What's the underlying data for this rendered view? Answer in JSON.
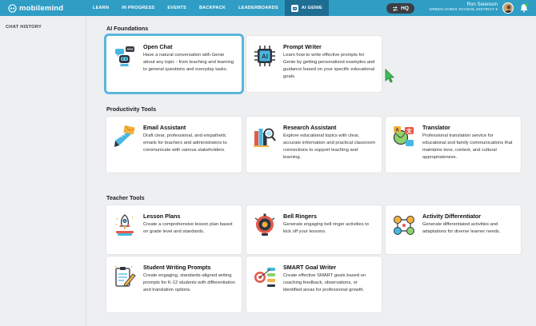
{
  "app": {
    "logo_text": "mobilemind"
  },
  "nav": {
    "items": [
      {
        "label": "LEARN"
      },
      {
        "label": "IN PROGRESS"
      },
      {
        "label": "EVENTS"
      },
      {
        "label": "BACKPACK"
      },
      {
        "label": "LEADERBOARDS"
      },
      {
        "label": "AI GENIE"
      }
    ],
    "active": "AI GENIE"
  },
  "hq": {
    "label": "HQ"
  },
  "user": {
    "name": "Ron Swanson",
    "district": "GREEN ACRES SCHOOL DISTRICT"
  },
  "sidebar": {
    "title": "CHAT HISTORY"
  },
  "sections": [
    {
      "title": "AI Foundations",
      "cards": [
        {
          "title": "Open Chat",
          "desc": "Have a natural conversation with Genie about any topic - from teaching and learning to general questions and everyday tasks.",
          "icon": "chat-robot-icon"
        },
        {
          "title": "Prompt Writer",
          "desc": "Learn how to write effective prompts for Genie by getting personalized examples and guidance based on your specific educational goals.",
          "icon": "ai-chip-icon"
        }
      ]
    },
    {
      "title": "Productivity Tools",
      "cards": [
        {
          "title": "Email Assistant",
          "desc": "Draft clear, professional, and empathetic emails for teachers and administrators to communicate with various stakeholders.",
          "icon": "email-icon"
        },
        {
          "title": "Research Assistant",
          "desc": "Explore educational topics with clear, accurate information and practical classroom connections to support teaching and learning.",
          "icon": "research-icon"
        },
        {
          "title": "Translator",
          "desc": "Professional translation service for educational and family communications that maintains tone, context, and cultural appropriateness.",
          "icon": "translate-icon"
        }
      ]
    },
    {
      "title": "Teacher Tools",
      "cards": [
        {
          "title": "Lesson Plans",
          "desc": "Create a comprehensive lesson plan based on grade level and standards.",
          "icon": "rocket-icon"
        },
        {
          "title": "Bell Ringers",
          "desc": "Generate engaging bell ringer activities to kick off your lessons.",
          "icon": "bell-icon"
        },
        {
          "title": "Activity Differentiator",
          "desc": "Generate differentiated activities and adaptations for diverse learner needs.",
          "icon": "differentiator-icon"
        },
        {
          "title": "Student Writing Prompts",
          "desc": "Create engaging, standards-aligned writing prompts for K-12 students with differentiation and translation options.",
          "icon": "writing-icon"
        },
        {
          "title": "SMART Goal Writer",
          "desc": "Create effective SMART goals based on coaching feedback, observations, or identified areas for professional growth.",
          "icon": "target-icon"
        }
      ]
    }
  ],
  "colors": {
    "topbar": "#2f9dc4",
    "active_tab": "#1e6d93",
    "selected_border": "#5ab6dc",
    "background": "#eeeff1"
  }
}
